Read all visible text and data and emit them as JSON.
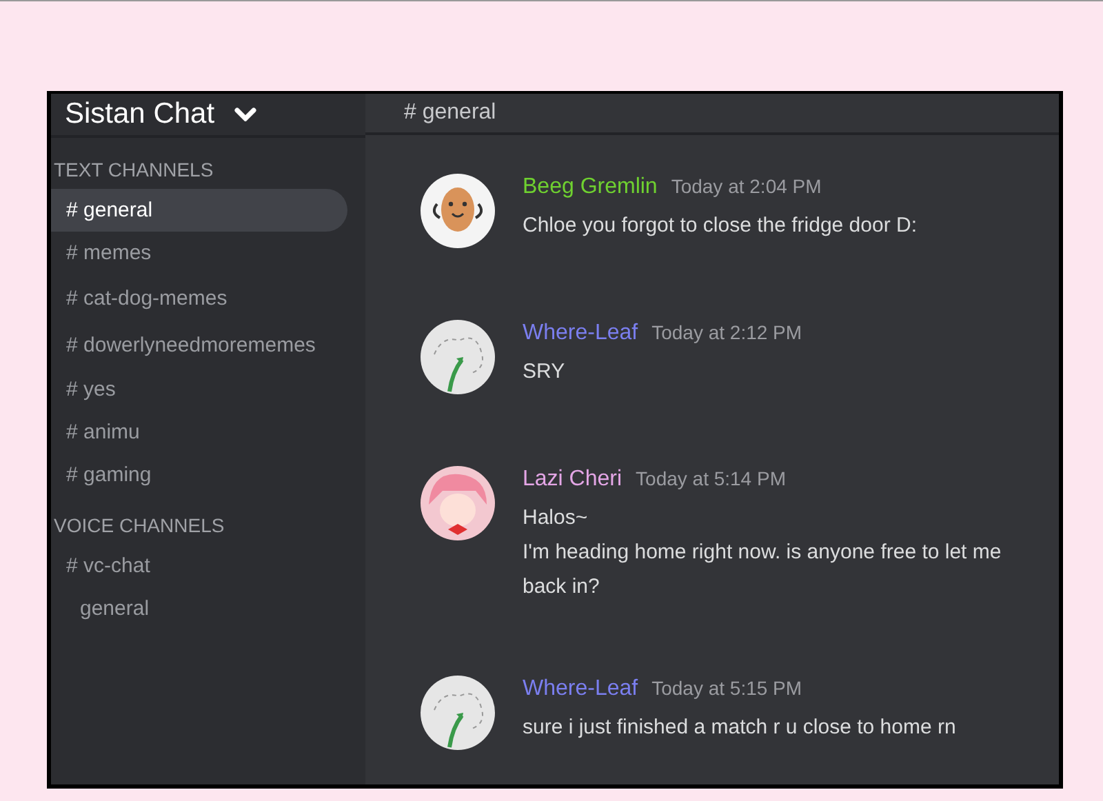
{
  "server": {
    "name": "Sistan Chat"
  },
  "channel_header": {
    "title": "# general"
  },
  "categories": [
    {
      "name": "TEXT CHANNELS",
      "channels": [
        {
          "label": "# general",
          "kind": "text",
          "selected": true
        },
        {
          "label": "# memes",
          "kind": "text",
          "selected": false
        },
        {
          "label": "# cat-dog-memes",
          "kind": "text",
          "selected": false
        },
        {
          "label": "# dowerlyneedmorememes",
          "kind": "text",
          "selected": false
        },
        {
          "label": "# yes",
          "kind": "text",
          "selected": false
        },
        {
          "label": "# animu",
          "kind": "text",
          "selected": false
        },
        {
          "label": "# gaming",
          "kind": "text",
          "selected": false
        }
      ]
    },
    {
      "name": "VOICE CHANNELS",
      "channels": [
        {
          "label": "# vc-chat",
          "kind": "text",
          "selected": false
        },
        {
          "label": "general",
          "kind": "voice",
          "selected": false
        }
      ]
    }
  ],
  "messages": [
    {
      "author": "Beeg Gremlin",
      "color": "#6fd130",
      "kind": "potato",
      "time": "Today at 2:04 PM",
      "lines": [
        "Chloe you forgot to close the fridge door D:"
      ]
    },
    {
      "author": "Where-Leaf",
      "color": "#7b7ff0",
      "kind": "leaf",
      "time": "Today at 2:12 PM",
      "lines": [
        "SRY"
      ]
    },
    {
      "author": "Lazi Cheri",
      "color": "#e4a6e6",
      "kind": "anime",
      "time": "Today at 5:14 PM",
      "lines": [
        "Halos~",
        "I'm heading home right now. is anyone free to let me back in?"
      ]
    },
    {
      "author": "Where-Leaf",
      "color": "#7b7ff0",
      "kind": "leaf",
      "time": "Today at 5:15 PM",
      "lines": [
        "sure i just finished a match r u close to home rn"
      ]
    }
  ]
}
